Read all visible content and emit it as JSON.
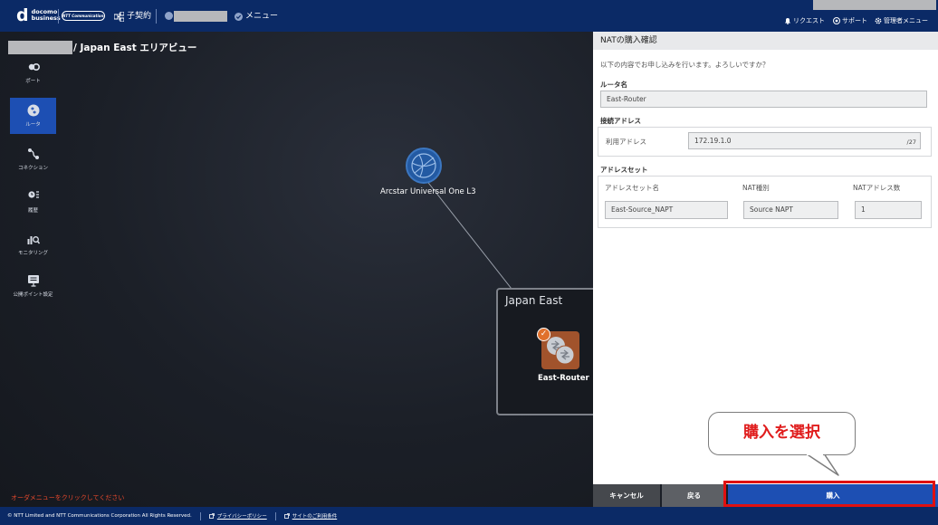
{
  "header": {
    "logo_mark": "d",
    "logo_line1": "docomo",
    "logo_line2": "business",
    "ntt_logo": "NTT Communications",
    "contract_label": "子契約",
    "menu_label": "メニュー",
    "request_label": "リクエスト",
    "support_label": "サポート",
    "admin_menu_label": "管理者メニュー"
  },
  "breadcrumb": {
    "area": "/ Japan East エリアビュー"
  },
  "sidebar": {
    "items": [
      {
        "label": "ポート",
        "icon": "port-icon",
        "active": false
      },
      {
        "label": "ルータ",
        "icon": "router-icon",
        "active": true
      },
      {
        "label": "コネクション",
        "icon": "connection-icon",
        "active": false
      },
      {
        "label": "履歴",
        "icon": "history-icon",
        "active": false
      },
      {
        "label": "モニタリング",
        "icon": "monitoring-icon",
        "active": false
      },
      {
        "label": "公開ポイント設定",
        "icon": "public-point-icon",
        "active": false
      }
    ]
  },
  "canvas": {
    "cloud_node_label": "Arcstar Universal One L3",
    "region_title": "Japan East",
    "router_node_label": "East-Router",
    "order_hint": "オーダメニューをクリックしてください"
  },
  "panel": {
    "title": "NATの購入確認",
    "message": "以下の内容でお申し込みを行います。よろしいですか？",
    "router_name_label": "ルータ名",
    "router_name_value": "East-Router",
    "connection_address_label": "接続アドレス",
    "usage_address_label": "利用アドレス",
    "usage_address_value": "172.19.1.0",
    "prefix": "/27",
    "address_set_label": "アドレスセット",
    "col_set_name": "アドレスセット名",
    "col_nat_type": "NAT種別",
    "col_nat_count": "NATアドレス数",
    "set_name_value": "East-Source_NAPT",
    "nat_type_value": "Source NAPT",
    "nat_count_value": "1"
  },
  "buttons": {
    "cancel": "キャンセル",
    "back": "戻る",
    "purchase": "購入"
  },
  "annotation": {
    "callout_text": "購入を選択"
  },
  "footer": {
    "copyright": "© NTT Limited and NTT Communications Corporation All Rights Reserved.",
    "privacy": "プライバシーポリシー",
    "terms": "サイトのご利用条件"
  },
  "colors": {
    "header_bg": "#0b2a66",
    "accent_blue": "#1d4fb3",
    "router_orange": "#a1532c",
    "highlight_red": "#e01010"
  }
}
